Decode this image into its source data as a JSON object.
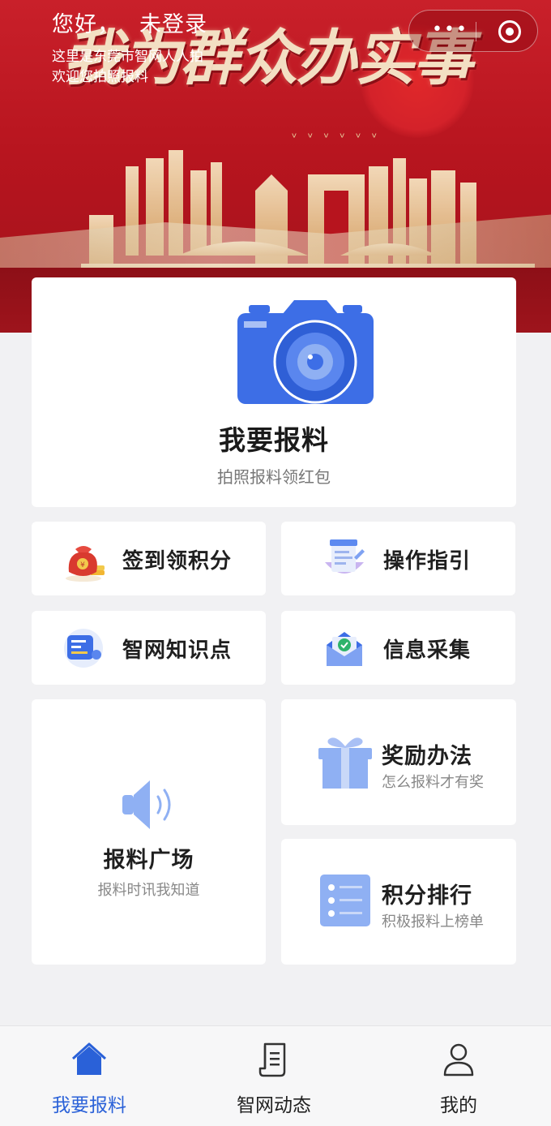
{
  "header": {
    "greeting": "您好，",
    "login_status": "未登录",
    "line1": "这里是东莞市智网人人拍",
    "line2": "欢迎您拍照报料",
    "slogan": "我为群众办实事",
    "capsule_more": "•••",
    "capsule_close": "close"
  },
  "main_card": {
    "title": "我要报料",
    "subtitle": "拍照报料领红包",
    "icon": "camera-icon"
  },
  "grid": [
    {
      "label": "签到领积分",
      "icon": "money-bag-icon"
    },
    {
      "label": "操作指引",
      "icon": "document-icon"
    },
    {
      "label": "智网知识点",
      "icon": "knowledge-icon"
    },
    {
      "label": "信息采集",
      "icon": "envelope-check-icon"
    }
  ],
  "square": {
    "title": "报料广场",
    "subtitle": "报料时讯我知道",
    "icon": "speaker-icon"
  },
  "reward": {
    "title": "奖励办法",
    "subtitle": "怎么报料才有奖",
    "icon": "gift-icon"
  },
  "rank": {
    "title": "积分排行",
    "subtitle": "积极报料上榜单",
    "icon": "list-icon"
  },
  "tabbar": [
    {
      "label": "我要报料",
      "icon": "home-icon",
      "active": true
    },
    {
      "label": "智网动态",
      "icon": "scroll-icon",
      "active": false
    },
    {
      "label": "我的",
      "icon": "user-icon",
      "active": false
    }
  ],
  "colors": {
    "banner_red": "#c9202a",
    "accent_blue": "#2a61d8",
    "icon_blue": "#3d6ee6",
    "light_blue": "#8fb0f3"
  }
}
